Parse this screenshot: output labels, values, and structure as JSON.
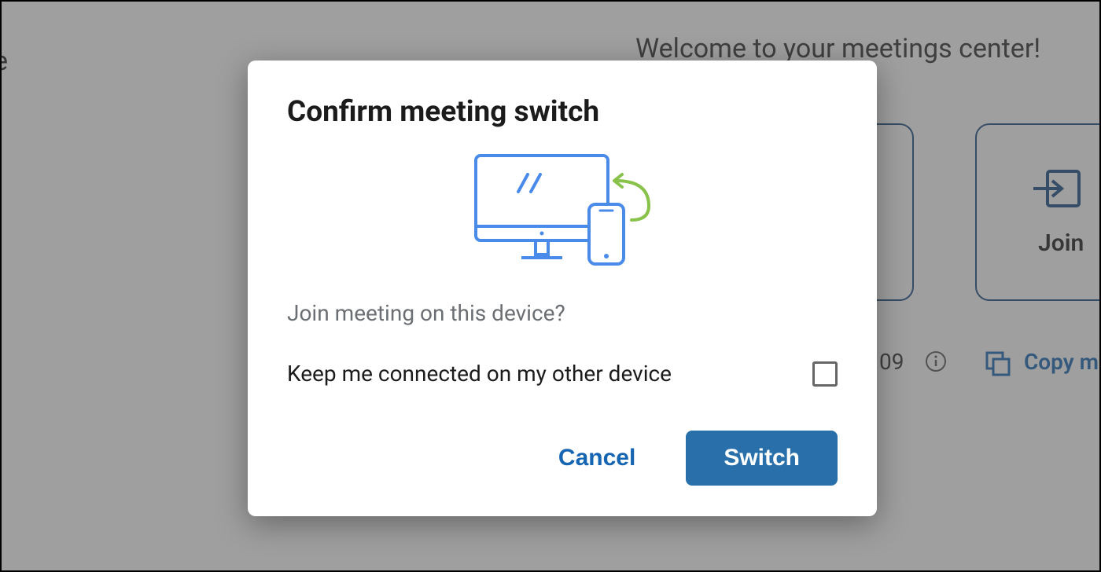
{
  "background": {
    "left_fragment": "e",
    "welcome": "Welcome to your meetings center!",
    "join_label": "Join",
    "partial_time": "09",
    "copy_label": "Copy m"
  },
  "modal": {
    "title": "Confirm meeting switch",
    "question": "Join meeting on this device?",
    "keep_connected_label": "Keep me connected on my other device",
    "keep_connected_checked": false,
    "cancel_label": "Cancel",
    "switch_label": "Switch"
  },
  "colors": {
    "primary_blue": "#2970ab",
    "link_blue": "#1665b3",
    "outline_blue": "#164b82",
    "illustration_blue": "#4a8bea",
    "illustration_green": "#8bc34a",
    "text_dark": "#1b1b1b",
    "text_muted": "#6b6f73"
  }
}
